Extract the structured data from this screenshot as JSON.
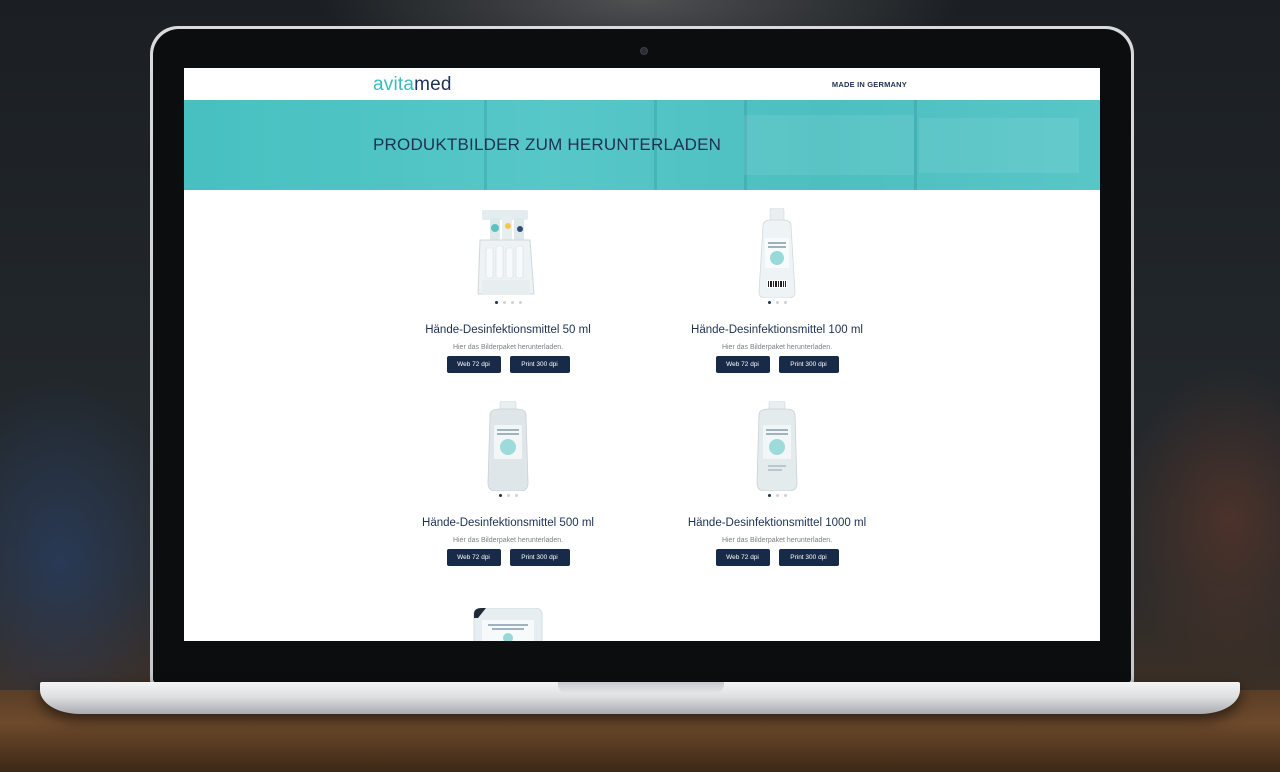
{
  "header": {
    "logo_part1": "avita",
    "logo_part2": "med",
    "made_in": "MADE IN GERMANY"
  },
  "hero": {
    "title": "PRODUKTBILDER ZUM HERUNTERLADEN"
  },
  "products": [
    {
      "title": "Hände-Desinfektionsmittel 50 ml",
      "subtitle": "Hier das Bilderpaket herunterladen.",
      "web_label": "Web 72 dpi",
      "print_label": "Print 300 dpi",
      "image": "display-box-image",
      "slides": 4,
      "active_slide": 1
    },
    {
      "title": "Hände-Desinfektionsmittel 100 ml",
      "subtitle": "Hier das Bilderpaket herunterladen.",
      "web_label": "Web 72 dpi",
      "print_label": "Print 300 dpi",
      "image": "bottle-image",
      "slides": 3,
      "active_slide": 1
    },
    {
      "title": "Hände-Desinfektionsmittel 500 ml",
      "subtitle": "Hier das Bilderpaket herunterladen.",
      "web_label": "Web 72 dpi",
      "print_label": "Print 300 dpi",
      "image": "bottle-image",
      "slides": 3,
      "active_slide": 1
    },
    {
      "title": "Hände-Desinfektionsmittel 1000 ml",
      "subtitle": "Hier das Bilderpaket herunterladen.",
      "web_label": "Web 72 dpi",
      "print_label": "Print 300 dpi",
      "image": "bottle-image",
      "slides": 3,
      "active_slide": 1
    }
  ],
  "colors": {
    "accent": "#4dc2c3",
    "brand_dark": "#1d3152",
    "button": "#172a48"
  }
}
